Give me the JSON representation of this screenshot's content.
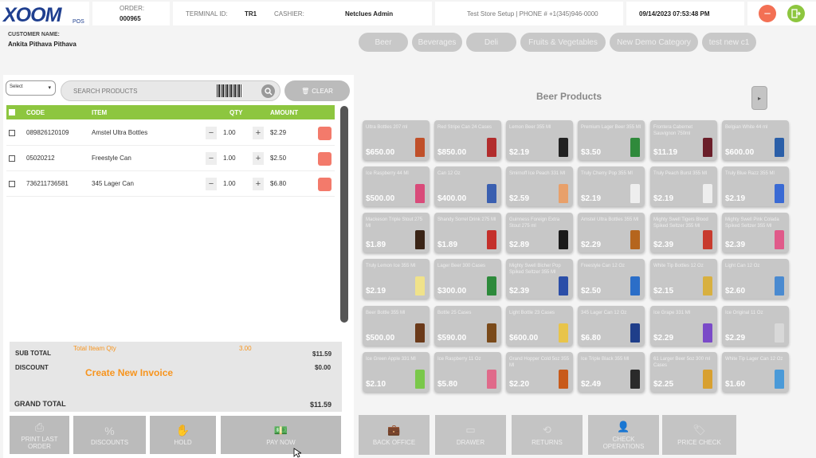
{
  "header": {
    "logo": "XOOM",
    "logo_sub": "POS",
    "order_label": "ORDER:",
    "order_value": "000965",
    "terminal_label": "TERMINAL ID:",
    "terminal_value": "TR1",
    "cashier_label": "CASHIER:",
    "cashier_value": "Netclues Admin",
    "store_info": "Test Store Setup | PHONE # +1(345)946-0000",
    "datetime": "09/14/2023 07:53:48 PM"
  },
  "customer": {
    "label": "CUSTOMER NAME:",
    "name": "Ankita Pithava Pithava"
  },
  "cart": {
    "select_label": "Select",
    "search_placeholder": "SEARCH PRODUCTS",
    "clear_label": "CLEAR",
    "columns": {
      "code": "CODE",
      "item": "ITEM",
      "qty": "QTY",
      "amount": "AMOUNT"
    },
    "rows": [
      {
        "code": "089826120109",
        "item": "Amstel Ultra Bottles",
        "qty": "1.00",
        "amount": "$2.29"
      },
      {
        "code": "05020212",
        "item": "Freestyle Can",
        "qty": "1.00",
        "amount": "$2.50"
      },
      {
        "code": "736211736581",
        "item": "345 Lager Can",
        "qty": "1.00",
        "amount": "$6.80"
      }
    ]
  },
  "totals": {
    "subtotal_label": "SUB TOTAL",
    "total_item_qty_label": "Total Iteam Qty",
    "total_item_qty": "3.00",
    "subtotal": "$11.59",
    "discount_label": "DISCOUNT",
    "discount": "$0.00",
    "create_invoice": "Create New Invoice",
    "grand_total_label": "GRAND TOTAL",
    "grand_total": "$11.59"
  },
  "left_actions": {
    "print_last": "PRINT LAST ORDER",
    "discounts": "DISCOUNTS",
    "hold": "HOLD",
    "pay_now": "PAY NOW"
  },
  "categories": [
    "Beer",
    "Beverages",
    "Deli",
    "Fruits & Vegetables",
    "New Demo Category",
    "test new c1"
  ],
  "products_title": "Beer Products",
  "products": [
    {
      "name": "Ultra Bottles 207 ml",
      "price": "$650.00",
      "color": "#c0502a"
    },
    {
      "name": "Red Stripe Can 24 Cases",
      "price": "$850.00",
      "color": "#b22d2d"
    },
    {
      "name": "Lemon Beer 355 Ml",
      "price": "$2.19",
      "color": "#222222"
    },
    {
      "name": "Premium Lager Beer 355 Ml",
      "price": "$3.50",
      "color": "#2f8a3b"
    },
    {
      "name": "Frontera Cabernet Sauvignon 750ml",
      "price": "$11.19",
      "color": "#6b1f2a"
    },
    {
      "name": "Belgian White 44 ml",
      "price": "$600.00",
      "color": "#2b5fa8"
    },
    {
      "name": "Ice Raspberry 44 Ml",
      "price": "$500.00",
      "color": "#d94b7a"
    },
    {
      "name": "Can 12 Oz",
      "price": "$400.00",
      "color": "#3a5fb0"
    },
    {
      "name": "Smirnoff Ice Peach 331 Ml",
      "price": "$2.59",
      "color": "#e8a06a"
    },
    {
      "name": "Truly Cherry Pop 355 Ml",
      "price": "$2.19",
      "color": "#eeeeee"
    },
    {
      "name": "Truly Peach Burst 355 Ml",
      "price": "$2.19",
      "color": "#eeeeee"
    },
    {
      "name": "Truly Blue Razz 355 Ml",
      "price": "$2.19",
      "color": "#3a6ad4"
    },
    {
      "name": "Mackeson Triple Stout 275 Ml",
      "price": "$1.89",
      "color": "#3a2416"
    },
    {
      "name": "Shandy Sorrel Drink 275 Ml",
      "price": "$1.89",
      "color": "#c4302b"
    },
    {
      "name": "Guinness Foreign Extra Stout 275 ml",
      "price": "$2.89",
      "color": "#1a1a1a"
    },
    {
      "name": "Amstel Ultra Bottles 355 Ml",
      "price": "$2.29",
      "color": "#b5651d"
    },
    {
      "name": "Mighty Swell Tigers Blood Spiked Seltzer 355 Ml",
      "price": "$2.39",
      "color": "#c83b2e"
    },
    {
      "name": "Mighty Swell Pink Colada Spiked Seltzer 355 Ml",
      "price": "$2.39",
      "color": "#e05a8a"
    },
    {
      "name": "Truly Lemon Ice 355 Ml",
      "price": "$2.19",
      "color": "#f0e28a"
    },
    {
      "name": "Lager Beer 300 Cases",
      "price": "$300.00",
      "color": "#2d8a3b"
    },
    {
      "name": "Mighty Swell Bicher Pop Spiked Seltzer 355 Ml",
      "price": "$2.39",
      "color": "#2b4ea8"
    },
    {
      "name": "Freestyle Can 12 Oz",
      "price": "$2.50",
      "color": "#2b6ec8"
    },
    {
      "name": "White Tip Bottles 12 Oz",
      "price": "$2.15",
      "color": "#d8b040"
    },
    {
      "name": "Light Can 12 Oz",
      "price": "$2.60",
      "color": "#4a8ad0"
    },
    {
      "name": "Beer Bottle 355 Ml",
      "price": "$500.00",
      "color": "#6b3a1a"
    },
    {
      "name": "Bottle 25 Cases",
      "price": "$590.00",
      "color": "#7a4a1a"
    },
    {
      "name": "Light Bottle 23 Cases",
      "price": "$600.00",
      "color": "#e8c44a"
    },
    {
      "name": "345 Lager Can 12 Oz",
      "price": "$6.80",
      "color": "#1f3e8a"
    },
    {
      "name": "Ice Grape 331 Ml",
      "price": "$2.29",
      "color": "#7a4ac8"
    },
    {
      "name": "Ice Original 11 Oz",
      "price": "$2.29",
      "color": "#d8d8d8"
    },
    {
      "name": "Ice Green Apple 331 Ml",
      "price": "$2.10",
      "color": "#7ac84a"
    },
    {
      "name": "Ice Raspberry 11 Oz",
      "price": "$5.80",
      "color": "#e06a8a"
    },
    {
      "name": "Grand Hopper Cold 5oz 355 Ml",
      "price": "$2.20",
      "color": "#c85a1a"
    },
    {
      "name": "Ice Triple Black 355 Ml",
      "price": "$2.49",
      "color": "#2a2a2a"
    },
    {
      "name": "61 Larger Beer 5oz 300 ml Cases",
      "price": "$2.25",
      "color": "#d8a030"
    },
    {
      "name": "White Tip Lager Can 12 Oz",
      "price": "$1.60",
      "color": "#4a9ad8"
    }
  ],
  "right_actions": {
    "back_office": "BACK OFFICE",
    "drawer": "DRAWER",
    "returns": "RETURNS",
    "check_operations": "CHECK OPERATIONS",
    "price_check": "PRICE CHECK"
  },
  "colors": {
    "accent_green": "#8dc63f",
    "orange": "#f7941d",
    "delete_red": "#f37a6b",
    "logout_green": "#8dc63f"
  }
}
